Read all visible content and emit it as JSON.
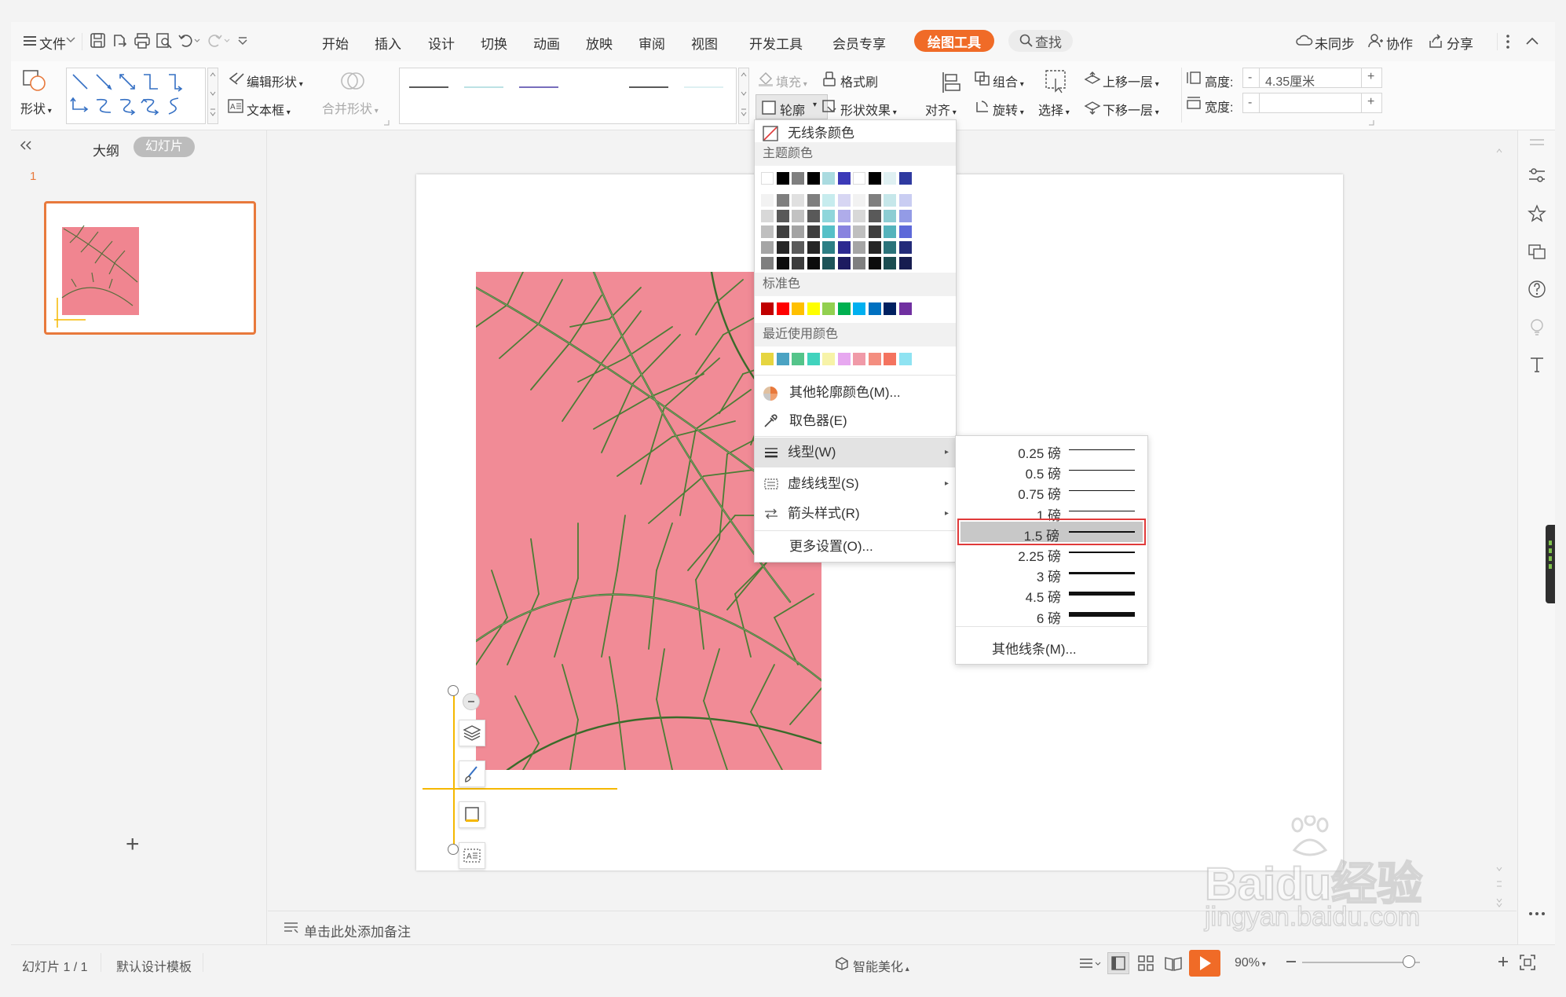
{
  "menubar": {
    "file": "文件",
    "tabs": [
      "开始",
      "插入",
      "设计",
      "切换",
      "动画",
      "放映",
      "审阅",
      "视图",
      "开发工具",
      "会员专享"
    ],
    "active_tab": "绘图工具",
    "search": "查找",
    "sync": "未同步",
    "collab": "协作",
    "share": "分享"
  },
  "ribbon": {
    "shape": "形状",
    "edit_shape": "编辑形状",
    "textbox": "文本框",
    "merge_shape": "合并形状",
    "fill": "填充",
    "format_brush": "格式刷",
    "outline": "轮廓",
    "shape_effect": "形状效果",
    "align": "对齐",
    "group": "组合",
    "rotate": "旋转",
    "select": "选择",
    "bring_forward": "上移一层",
    "send_backward": "下移一层",
    "height_label": "高度:",
    "height_value": "4.35厘米",
    "width_label": "宽度:",
    "width_value": "",
    "minus": "-",
    "plus": "+"
  },
  "left_panel": {
    "outline_tab": "大纲",
    "slides_tab": "幻灯片",
    "slide_number": "1",
    "add": "+"
  },
  "notes": {
    "placeholder": "单击此处添加备注"
  },
  "status": {
    "slide_counter": "幻灯片 1 / 1",
    "template": "默认设计模板",
    "smart": "智能美化",
    "zoom": "90%"
  },
  "outline_menu": {
    "no_line": "无线条颜色",
    "theme_colors": "主题颜色",
    "standard_colors": "标准色",
    "recent_colors": "最近使用颜色",
    "more_colors": "其他轮廓颜色(M)...",
    "eyedropper": "取色器(E)",
    "line_type": "线型(W)",
    "dash_type": "虚线线型(S)",
    "arrow_style": "箭头样式(R)",
    "more_settings": "更多设置(O)...",
    "theme_top": [
      "#ffffff",
      "#000000",
      "#7f7f7f",
      "#000000",
      "#aadbe0",
      "#3c3ab8",
      "#ffffff",
      "#000000",
      "#dff0f2",
      "#2f3aa0"
    ],
    "theme_rows": [
      [
        "#f2f2f2",
        "#7f7f7f",
        "#e0e0e0",
        "#7f7f7f",
        "#c7ecee",
        "#d7d6f3",
        "#f2f2f2",
        "#7f7f7f",
        "#c6e7ea",
        "#c9cdf2"
      ],
      [
        "#d8d8d8",
        "#595959",
        "#c2c2c2",
        "#595959",
        "#8fd6db",
        "#afacea",
        "#d8d8d8",
        "#595959",
        "#8dcdd3",
        "#939be6"
      ],
      [
        "#bfbfbf",
        "#3f3f3f",
        "#a3a3a3",
        "#3f3f3f",
        "#56c0c7",
        "#8883df",
        "#bfbfbf",
        "#3f3f3f",
        "#55b3bc",
        "#5d69d9"
      ],
      [
        "#a5a5a5",
        "#262626",
        "#5b5b5b",
        "#262626",
        "#2c7f85",
        "#2c2990",
        "#a5a5a5",
        "#262626",
        "#2b737a",
        "#232b79"
      ],
      [
        "#7f7f7f",
        "#0c0c0c",
        "#3d3d3d",
        "#0c0c0c",
        "#1d5459",
        "#1d1b60",
        "#7f7f7f",
        "#0c0c0c",
        "#1c4d51",
        "#171d50"
      ]
    ],
    "standard": [
      "#c00000",
      "#ff0000",
      "#ffc000",
      "#ffff00",
      "#92d050",
      "#00b050",
      "#00b0f0",
      "#0070c0",
      "#002060",
      "#7030a0"
    ],
    "recent": [
      "#e6d540",
      "#4ba3c3",
      "#54c48a",
      "#41d3bd",
      "#f7f3a8",
      "#e7a8f0",
      "#f09aa8",
      "#f48e80",
      "#f4735f",
      "#8fe3f2"
    ]
  },
  "line_submenu": {
    "items": [
      {
        "label": "0.25 磅",
        "weight": 0.25
      },
      {
        "label": "0.5 磅",
        "weight": 0.5
      },
      {
        "label": "0.75 磅",
        "weight": 0.75
      },
      {
        "label": "1 磅",
        "weight": 1
      },
      {
        "label": "1.5 磅",
        "weight": 1.5
      },
      {
        "label": "2.25 磅",
        "weight": 2.25
      },
      {
        "label": "3 磅",
        "weight": 3
      },
      {
        "label": "4.5 磅",
        "weight": 4.5
      },
      {
        "label": "6 磅",
        "weight": 6
      }
    ],
    "selected_index": 4,
    "more": "其他线条(M)..."
  },
  "watermark": {
    "text": "Baidu经验",
    "url": "jingyan.baidu.com"
  },
  "colors": {
    "accent": "#f06b27",
    "selection_outline": "#e03a3a",
    "slide_thumb_border": "#e8793c",
    "connector": "#f5b800",
    "photo_bg": "#f08590"
  }
}
